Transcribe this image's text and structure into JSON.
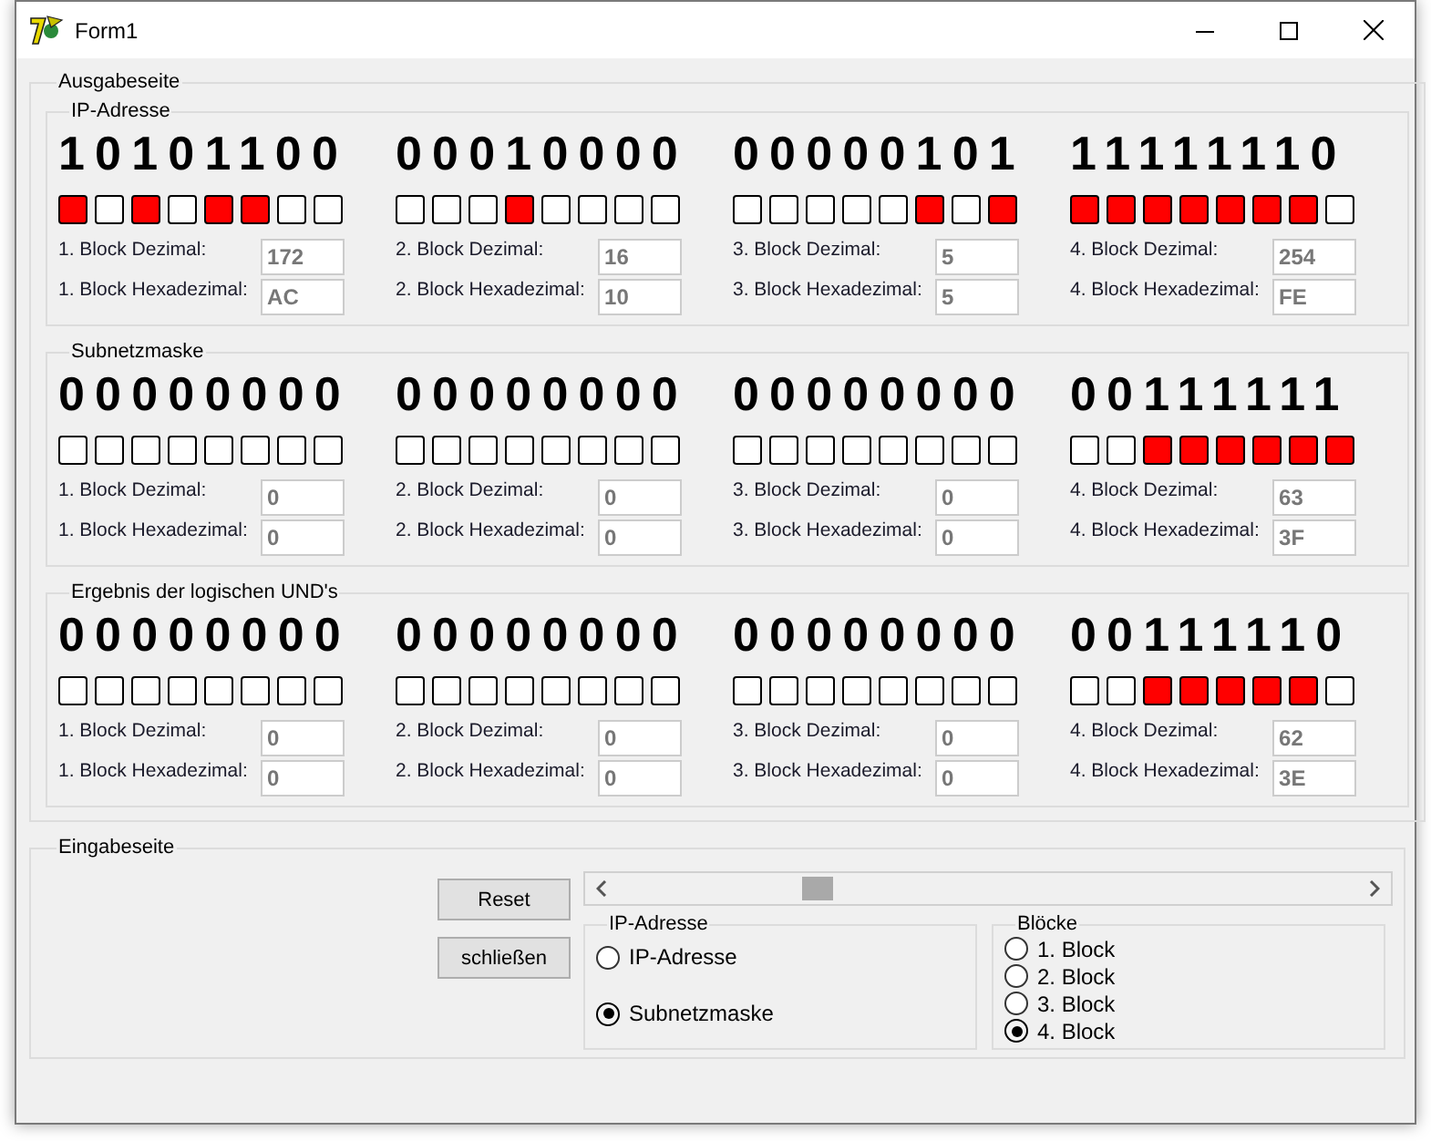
{
  "window": {
    "title": "Form1"
  },
  "output": {
    "title": "Ausgabeseite",
    "groups": [
      {
        "title": "IP-Adresse",
        "blocks": [
          {
            "bits": "10101100",
            "leds": [
              {
                "on": true
              },
              {
                "on": false
              },
              {
                "on": true
              },
              {
                "on": false
              },
              {
                "on": true
              },
              {
                "on": true
              },
              {
                "on": false
              },
              {
                "on": false
              }
            ],
            "dec_label": "1. Block Dezimal:",
            "dec": "172",
            "hex_label": "1. Block Hexadezimal:",
            "hex": "AC"
          },
          {
            "bits": "00010000",
            "leds": [
              {
                "on": false
              },
              {
                "on": false
              },
              {
                "on": false
              },
              {
                "on": true
              },
              {
                "on": false
              },
              {
                "on": false
              },
              {
                "on": false
              },
              {
                "on": false
              }
            ],
            "dec_label": "2. Block Dezimal:",
            "dec": "16",
            "hex_label": "2. Block Hexadezimal:",
            "hex": "10"
          },
          {
            "bits": "00000101",
            "leds": [
              {
                "on": false
              },
              {
                "on": false
              },
              {
                "on": false
              },
              {
                "on": false
              },
              {
                "on": false
              },
              {
                "on": true
              },
              {
                "on": false
              },
              {
                "on": true
              }
            ],
            "dec_label": "3. Block Dezimal:",
            "dec": "5",
            "hex_label": "3. Block Hexadezimal:",
            "hex": "5"
          },
          {
            "bits": "11111110",
            "leds": [
              {
                "on": true
              },
              {
                "on": true
              },
              {
                "on": true
              },
              {
                "on": true
              },
              {
                "on": true
              },
              {
                "on": true
              },
              {
                "on": true
              },
              {
                "on": false
              }
            ],
            "dec_label": "4. Block Dezimal:",
            "dec": "254",
            "hex_label": "4. Block Hexadezimal:",
            "hex": "FE"
          }
        ]
      },
      {
        "title": "Subnetzmaske",
        "blocks": [
          {
            "bits": "00000000",
            "leds": [
              {
                "on": false
              },
              {
                "on": false
              },
              {
                "on": false
              },
              {
                "on": false
              },
              {
                "on": false
              },
              {
                "on": false
              },
              {
                "on": false
              },
              {
                "on": false
              }
            ],
            "dec_label": "1. Block Dezimal:",
            "dec": "0",
            "hex_label": "1. Block Hexadezimal:",
            "hex": "0"
          },
          {
            "bits": "00000000",
            "leds": [
              {
                "on": false
              },
              {
                "on": false
              },
              {
                "on": false
              },
              {
                "on": false
              },
              {
                "on": false
              },
              {
                "on": false
              },
              {
                "on": false
              },
              {
                "on": false
              }
            ],
            "dec_label": "2. Block Dezimal:",
            "dec": "0",
            "hex_label": "2. Block Hexadezimal:",
            "hex": "0"
          },
          {
            "bits": "00000000",
            "leds": [
              {
                "on": false
              },
              {
                "on": false
              },
              {
                "on": false
              },
              {
                "on": false
              },
              {
                "on": false
              },
              {
                "on": false
              },
              {
                "on": false
              },
              {
                "on": false
              }
            ],
            "dec_label": "3. Block Dezimal:",
            "dec": "0",
            "hex_label": "3. Block Hexadezimal:",
            "hex": "0"
          },
          {
            "bits": "00111111",
            "leds": [
              {
                "on": false
              },
              {
                "on": false
              },
              {
                "on": true
              },
              {
                "on": true
              },
              {
                "on": true
              },
              {
                "on": true
              },
              {
                "on": true
              },
              {
                "on": true
              }
            ],
            "dec_label": "4. Block Dezimal:",
            "dec": "63",
            "hex_label": "4. Block Hexadezimal:",
            "hex": "3F"
          }
        ]
      },
      {
        "title": "Ergebnis der logischen UND's",
        "blocks": [
          {
            "bits": "00000000",
            "leds": [
              {
                "on": false
              },
              {
                "on": false
              },
              {
                "on": false
              },
              {
                "on": false
              },
              {
                "on": false
              },
              {
                "on": false
              },
              {
                "on": false
              },
              {
                "on": false
              }
            ],
            "dec_label": "1. Block Dezimal:",
            "dec": "0",
            "hex_label": "1. Block Hexadezimal:",
            "hex": "0"
          },
          {
            "bits": "00000000",
            "leds": [
              {
                "on": false
              },
              {
                "on": false
              },
              {
                "on": false
              },
              {
                "on": false
              },
              {
                "on": false
              },
              {
                "on": false
              },
              {
                "on": false
              },
              {
                "on": false
              }
            ],
            "dec_label": "2. Block Dezimal:",
            "dec": "0",
            "hex_label": "2. Block Hexadezimal:",
            "hex": "0"
          },
          {
            "bits": "00000000",
            "leds": [
              {
                "on": false
              },
              {
                "on": false
              },
              {
                "on": false
              },
              {
                "on": false
              },
              {
                "on": false
              },
              {
                "on": false
              },
              {
                "on": false
              },
              {
                "on": false
              }
            ],
            "dec_label": "3. Block Dezimal:",
            "dec": "0",
            "hex_label": "3. Block Hexadezimal:",
            "hex": "0"
          },
          {
            "bits": "00111110",
            "leds": [
              {
                "on": false
              },
              {
                "on": false
              },
              {
                "on": true
              },
              {
                "on": true
              },
              {
                "on": true
              },
              {
                "on": true
              },
              {
                "on": true
              },
              {
                "on": false
              }
            ],
            "dec_label": "4. Block Dezimal:",
            "dec": "62",
            "hex_label": "4. Block Hexadezimal:",
            "hex": "3E"
          }
        ]
      }
    ]
  },
  "input": {
    "title": "Eingabeseite",
    "buttons": [
      "Reset",
      "schließen"
    ],
    "slider": {
      "level": 0.25
    },
    "source": {
      "title": "IP-Adresse",
      "options": [
        {
          "label": "IP-Adresse",
          "selected": false
        },
        {
          "label": "Subnetzmaske",
          "selected": true
        }
      ]
    },
    "blocks": {
      "title": "Blöcke",
      "options": [
        {
          "label": "1. Block",
          "selected": false
        },
        {
          "label": "2. Block",
          "selected": false
        },
        {
          "label": "3. Block",
          "selected": false
        },
        {
          "label": "4. Block",
          "selected": true
        }
      ]
    }
  }
}
